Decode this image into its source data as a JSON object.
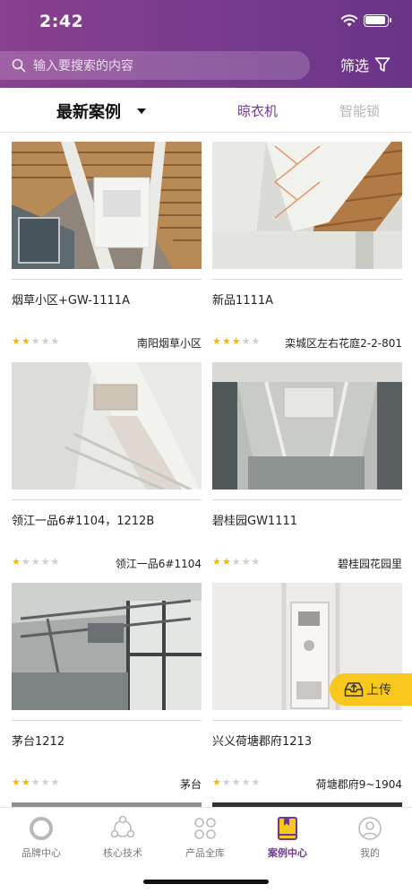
{
  "status_bar": {
    "time": "2:42"
  },
  "search": {
    "placeholder": "输入要搜索的内容",
    "filter_label": "筛选"
  },
  "category": {
    "selected": "最新案例"
  },
  "tabs": [
    {
      "label": "晾衣机",
      "active": true
    },
    {
      "label": "智能锁",
      "active": false
    }
  ],
  "cases": [
    {
      "title": "烟草小区+GW-1111A",
      "rating": 2,
      "max_rating": 5,
      "location": "南阳烟草小区"
    },
    {
      "title": "新品1111A",
      "rating": 3,
      "max_rating": 5,
      "location": "栾城区左右花庭2-2-801"
    },
    {
      "title": "领江一品6#1104，1212B",
      "rating": 1,
      "max_rating": 5,
      "location": "领江一品6#1104"
    },
    {
      "title": "碧桂园GW1111",
      "rating": 2,
      "max_rating": 5,
      "location": "碧桂园花园里"
    },
    {
      "title": "茅台1212",
      "rating": 2,
      "max_rating": 5,
      "location": "茅台"
    },
    {
      "title": "兴义荷塘郡府1213",
      "rating": 1,
      "max_rating": 5,
      "location": "荷塘郡府9~1904"
    }
  ],
  "upload": {
    "label": "上传"
  },
  "tabbar": [
    {
      "label": "品牌中心",
      "icon": "brand-circle-icon",
      "active": false
    },
    {
      "label": "核心技术",
      "icon": "tech-nodes-icon",
      "active": false
    },
    {
      "label": "产品全库",
      "icon": "product-grid-icon",
      "active": false
    },
    {
      "label": "案例中心",
      "icon": "case-book-icon",
      "active": true
    },
    {
      "label": "我的",
      "icon": "profile-icon",
      "active": false
    }
  ],
  "colors": {
    "brand_purple": "#7a3c8e",
    "accent_yellow": "#f7c71d",
    "star_on": "#f5b800",
    "star_off": "#cfcfcf"
  }
}
